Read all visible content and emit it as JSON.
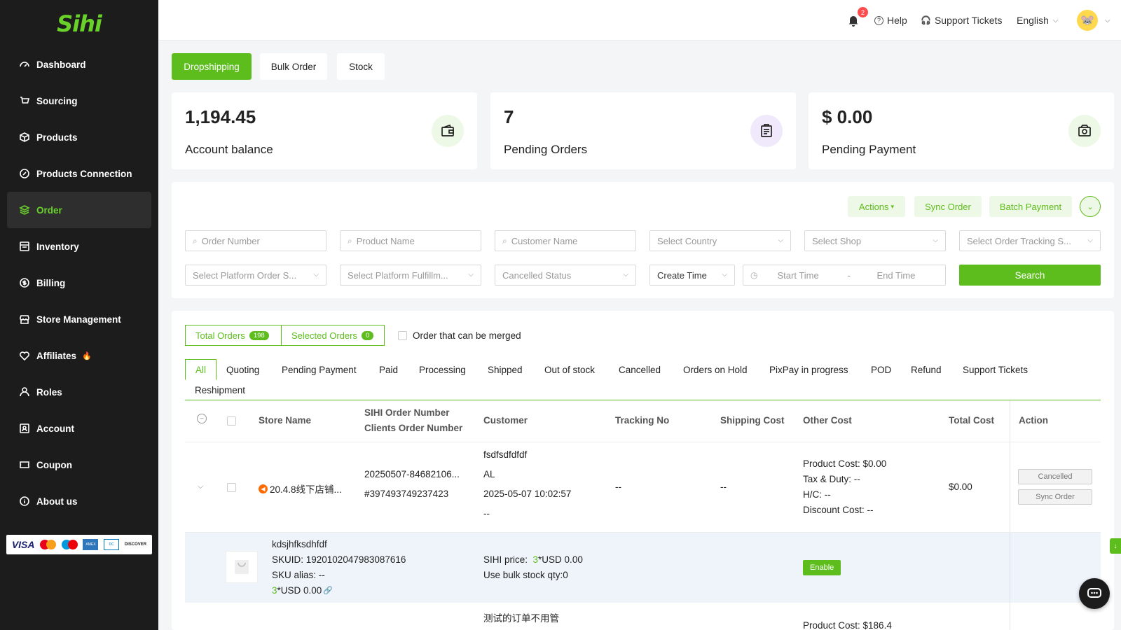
{
  "brand": {
    "logo_text": "Sihi",
    "accent": "#5dbd1c"
  },
  "sidebar": {
    "items": [
      {
        "label": "Dashboard",
        "icon": "dashboard-icon"
      },
      {
        "label": "Sourcing",
        "icon": "cart-icon"
      },
      {
        "label": "Products",
        "icon": "box-icon"
      },
      {
        "label": "Products Connection",
        "icon": "link-icon"
      },
      {
        "label": "Order",
        "icon": "layers-icon",
        "active": true
      },
      {
        "label": "Inventory",
        "icon": "inventory-icon"
      },
      {
        "label": "Billing",
        "icon": "dollar-icon"
      },
      {
        "label": "Store Management",
        "icon": "store-icon"
      },
      {
        "label": "Affiliates",
        "icon": "heart-handshake-icon",
        "badge_icon": "flame-icon"
      },
      {
        "label": "Roles",
        "icon": "user-icon"
      },
      {
        "label": "Account",
        "icon": "id-card-icon"
      },
      {
        "label": "Coupon",
        "icon": "ticket-icon"
      },
      {
        "label": "About us",
        "icon": "info-icon"
      }
    ],
    "payment_logos": [
      "VISA",
      "Mastercard",
      "Maestro",
      "American Express",
      "Diners Club",
      "DISCOVER"
    ]
  },
  "header": {
    "notification_count": "2",
    "help": "Help",
    "support_tickets": "Support Tickets",
    "language": "English"
  },
  "top_tabs": [
    "Dropshipping",
    "Bulk Order",
    "Stock"
  ],
  "stats": [
    {
      "value": "1,194.45",
      "label": "Account balance",
      "icon": "wallet-icon",
      "icon_bg": "#eef8e6"
    },
    {
      "value": "7",
      "label": "Pending Orders",
      "icon": "clipboard-icon",
      "icon_bg": "#efe9fb"
    },
    {
      "value": "$ 0.00",
      "label": "Pending Payment",
      "icon": "cash-icon",
      "icon_bg": "#eef8e6"
    }
  ],
  "actions": {
    "actions": "Actions",
    "sync_order": "Sync Order",
    "batch_payment": "Batch Payment"
  },
  "filters": {
    "order_number": "Order Number",
    "product_name": "Product Name",
    "customer_name": "Customer Name",
    "country": "Select Country",
    "shop": "Select Shop",
    "tracking": "Select Order Tracking S...",
    "platform_order": "Select Platform Order S...",
    "platform_fulfillment": "Select Platform Fulfillm...",
    "cancelled_status": "Cancelled Status",
    "create_time": "Create Time",
    "start_time": "Start Time",
    "dash": "-",
    "end_time": "End Time",
    "search": "Search"
  },
  "orders": {
    "total_label": "Total Orders",
    "total_count": "198",
    "selected_label": "Selected Orders",
    "selected_count": "0",
    "merge_label": "Order that can be merged",
    "tabs": [
      "All",
      "Quoting",
      "Pending Payment",
      "Paid",
      "Processing",
      "Shipped",
      "Out of stock",
      "Cancelled",
      "Orders on Hold",
      "PixPay in progress",
      "POD",
      "Refund",
      "Support Tickets",
      "Reshipment"
    ],
    "columns": {
      "store": "Store Name",
      "sihi_no": "SIHI Order Number",
      "client_no": "Clients Order Number",
      "customer": "Customer",
      "tracking": "Tracking No",
      "shipping": "Shipping Cost",
      "other": "Other Cost",
      "total": "Total Cost",
      "action": "Action"
    },
    "row1": {
      "store": "20.4.8线下店铺...",
      "sihi_no": "20250507-84682106...",
      "client_no": "#397493749237423",
      "customer_name": "fsdfsdfdfdf",
      "customer_country": "AL",
      "customer_time": "2025-05-07 10:02:57",
      "customer_extra": "--",
      "tracking": "--",
      "shipping": "--",
      "product_cost": "Product Cost:  $0.00",
      "tax": "Tax & Duty:  --",
      "hc": "H/C:  --",
      "discount": "Discount Cost:  --",
      "total": "$0.00",
      "btn_cancelled": "Cancelled",
      "btn_sync": "Sync Order"
    },
    "item1": {
      "name": "kdsjhfksdhfdf",
      "skuid": "SKUID:  1920102047983087616",
      "alias": "SKU alias:  --",
      "qty": "3",
      "price_text": "*USD 0.00",
      "sihi_price_label": "SIHI price:  ",
      "sihi_qty": "3",
      "sihi_price_val": "*USD 0.00",
      "bulk": "Use bulk stock qty:0",
      "enable": "Enable"
    },
    "row2": {
      "customer_name": "测试的订单不用管",
      "product_cost": "Product Cost:  $186.4"
    }
  }
}
